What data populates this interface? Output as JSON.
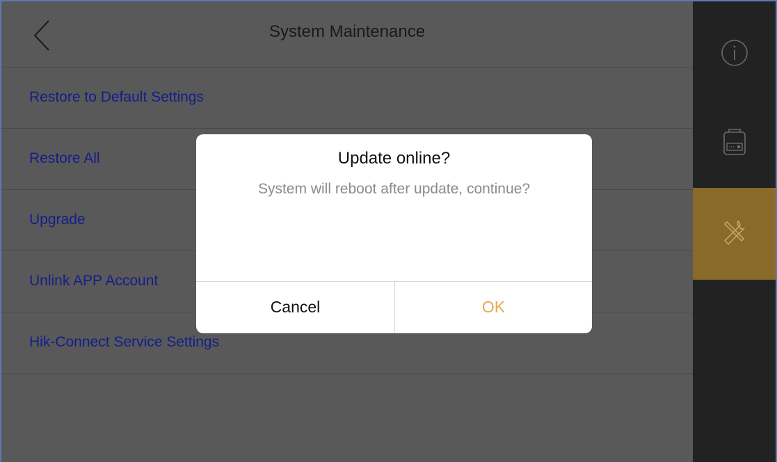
{
  "header": {
    "title": "System Maintenance",
    "back_icon": "chevron-left-icon"
  },
  "menu": {
    "items": [
      {
        "label": "Restore to Default Settings"
      },
      {
        "label": "Restore All"
      },
      {
        "label": "Upgrade"
      },
      {
        "label": "Unlink APP Account"
      },
      {
        "label": "Hik-Connect Service Settings"
      }
    ]
  },
  "sidebar": {
    "items": [
      {
        "icon": "info-icon",
        "active": false
      },
      {
        "icon": "device-icon",
        "active": false
      },
      {
        "icon": "tools-icon",
        "active": true
      }
    ]
  },
  "dialog": {
    "title": "Update online?",
    "message": "System will reboot after update, continue?",
    "cancel_label": "Cancel",
    "ok_label": "OK"
  },
  "colors": {
    "menu_text": "#141e8a",
    "active_sidebar": "#8a6a28",
    "ok_text": "#e4a94f",
    "overlay_bg": "#595959"
  }
}
